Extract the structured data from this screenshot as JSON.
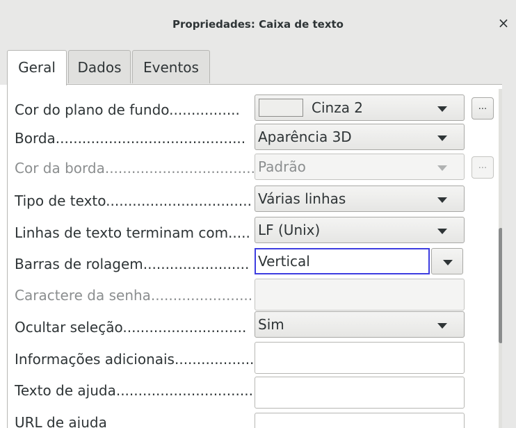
{
  "window": {
    "title": "Propriedades: Caixa de texto",
    "close_glyph": "×"
  },
  "tabs": [
    {
      "label": "Geral",
      "active": true
    },
    {
      "label": "Dados",
      "active": false
    },
    {
      "label": "Eventos",
      "active": false
    }
  ],
  "properties": [
    {
      "label": "Cor do plano de fundo................",
      "control": "color",
      "value": "Cinza 2",
      "swatch_color": "#eeeeec",
      "has_dots": true,
      "dots": "..."
    },
    {
      "label": "Borda...........................................",
      "control": "dropdown",
      "value": "Aparência 3D"
    },
    {
      "label": "Cor da borda..................................",
      "control": "dropdown",
      "value": "Padrão",
      "disabled": true,
      "has_dots": true,
      "dots": "..."
    },
    {
      "label": "Tipo de texto.................................",
      "control": "dropdown",
      "value": "Várias linhas"
    },
    {
      "label": "Linhas de texto terminam com.....",
      "control": "dropdown",
      "value": "LF (Unix)"
    },
    {
      "label": "Barras de rolagem........................",
      "control": "combo-focused",
      "value": "Vertical"
    },
    {
      "label": "Caractere da senha.......................",
      "control": "text",
      "value": "",
      "disabled": true
    },
    {
      "label": "Ocultar seleção............................",
      "control": "dropdown",
      "value": "Sim"
    },
    {
      "label": "Informações adicionais..................",
      "control": "text",
      "value": ""
    },
    {
      "label": "Texto de ajuda...............................",
      "control": "text",
      "value": ""
    },
    {
      "label": "URL de ajuda",
      "control": "text",
      "value": ""
    }
  ],
  "scrollbar": {
    "position_fraction": 0.62,
    "visible_fraction": 0.34
  },
  "colors": {
    "focus_border": "#3d3de0",
    "window_bg": "#e8e8e7"
  }
}
